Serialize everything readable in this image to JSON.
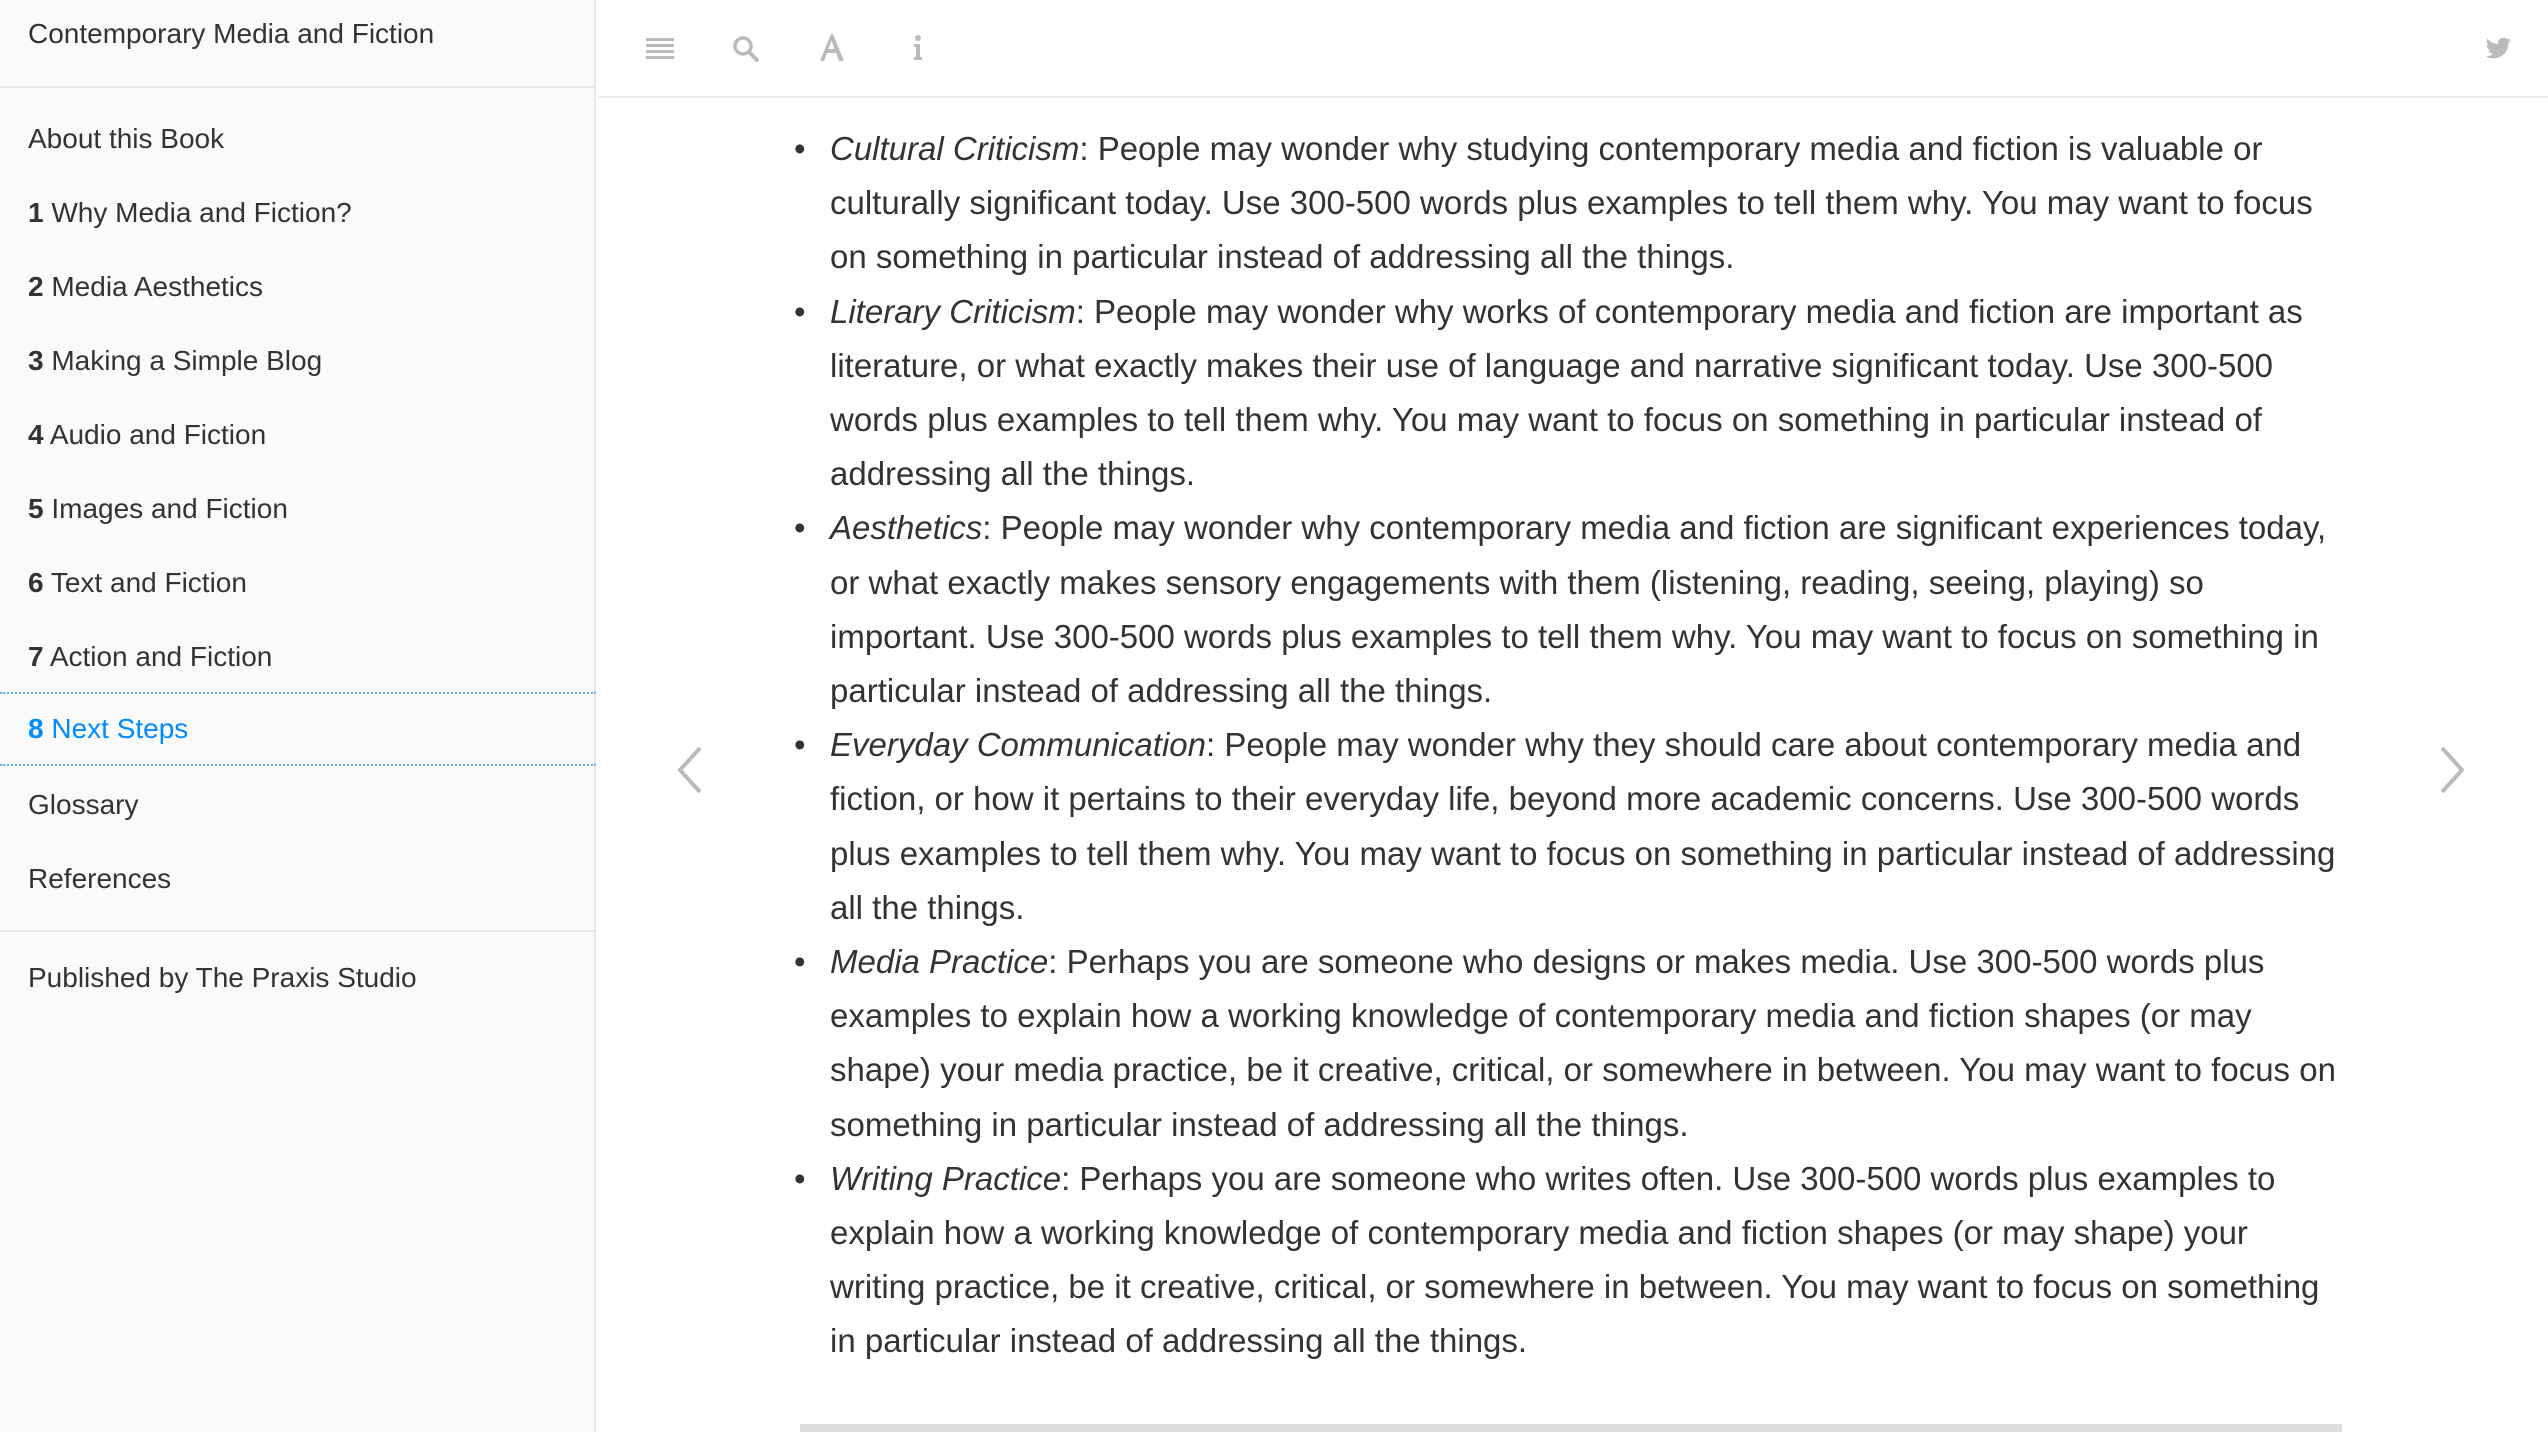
{
  "book": {
    "title": "Contemporary Media and Fiction"
  },
  "sidebar": {
    "items": [
      {
        "num": "",
        "label": "About this Book"
      },
      {
        "num": "1",
        "label": "Why Media and Fiction?"
      },
      {
        "num": "2",
        "label": "Media Aesthetics"
      },
      {
        "num": "3",
        "label": "Making a Simple Blog"
      },
      {
        "num": "4",
        "label": "Audio and Fiction"
      },
      {
        "num": "5",
        "label": "Images and Fiction"
      },
      {
        "num": "6",
        "label": "Text and Fiction"
      },
      {
        "num": "7",
        "label": "Action and Fiction"
      },
      {
        "num": "8",
        "label": "Next Steps",
        "active": true
      },
      {
        "num": "",
        "label": "Glossary"
      },
      {
        "num": "",
        "label": "References"
      }
    ],
    "publisher": "Published by The Praxis Studio"
  },
  "toolbar": {
    "icons": [
      "menu-icon",
      "search-icon",
      "font-icon",
      "info-icon",
      "twitter-icon"
    ],
    "icon_color": "#bbbbbb"
  },
  "accent_color": "#008cff",
  "content": {
    "items": [
      {
        "term": "Cultural Criticism",
        "text": ": People may wonder why studying contemporary media and fiction is valuable or culturally significant today. Use 300-500 words plus examples to tell them why. You may want to focus on something in particular instead of addressing all the things."
      },
      {
        "term": "Literary Criticism",
        "text": ": People may wonder why works of contemporary media and fiction are important as literature, or what exactly makes their use of language and narrative significant today. Use 300-500 words plus examples to tell them why. You may want to focus on something in particular instead of addressing all the things."
      },
      {
        "term": "Aesthetics",
        "text": ": People may wonder why contemporary media and fiction are significant experiences today, or what exactly makes sensory engagements with them (listening, reading, seeing, playing) so important. Use 300-500 words plus examples to tell them why. You may want to focus on something in particular instead of addressing all the things."
      },
      {
        "term": "Everyday Communication",
        "text": ": People may wonder why they should care about contemporary media and fiction, or how it pertains to their everyday life, beyond more academic concerns. Use 300-500 words plus examples to tell them why. You may want to focus on something in particular instead of addressing all the things."
      },
      {
        "term": "Media Practice",
        "text": ": Perhaps you are someone who designs or makes media. Use 300-500 words plus examples to explain how a working knowledge of contemporary media and fiction shapes (or may shape) your media practice, be it creative, critical, or somewhere in between. You may want to focus on something in particular instead of addressing all the things."
      },
      {
        "term": "Writing Practice",
        "text": ": Perhaps you are someone who writes often. Use 300-500 words plus examples to explain how a working knowledge of contemporary media and fiction shapes (or may shape) your writing practice, be it creative, critical, or somewhere in between. You may want to focus on something in particular instead of addressing all the things."
      }
    ]
  }
}
